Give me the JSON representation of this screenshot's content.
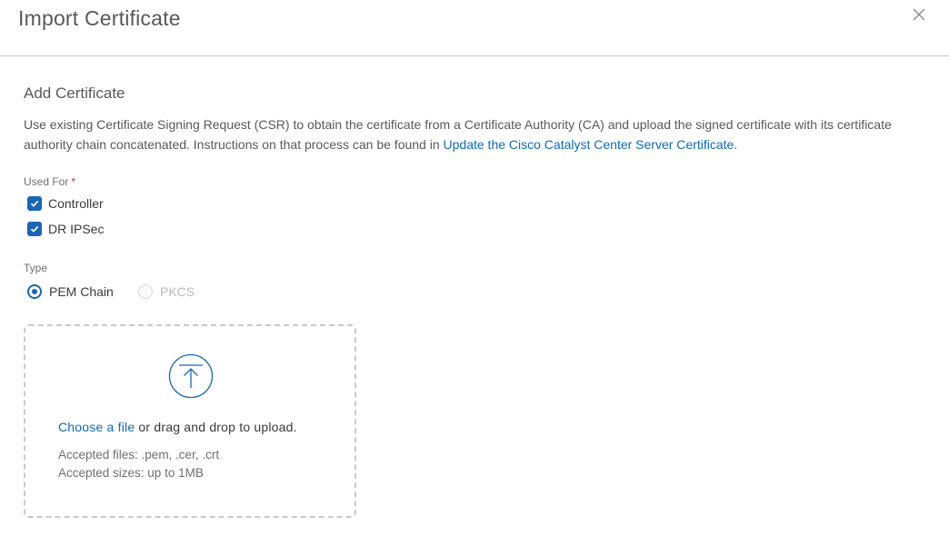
{
  "dialog": {
    "title": "Import Certificate",
    "close_icon": "close-icon"
  },
  "section": {
    "title": "Add Certificate",
    "description_text": "Use existing Certificate Signing Request (CSR) to obtain the certificate from a Certificate Authority (CA) and upload the signed certificate with its certificate authority chain concatenated. Instructions on that process can be found in",
    "description_link": "Update the Cisco Catalyst Center Server Certificate",
    "description_end": "."
  },
  "used_for": {
    "label": "Used For",
    "required_mark": "*",
    "options": [
      {
        "label": "Controller",
        "checked": true
      },
      {
        "label": "DR IPSec",
        "checked": true
      }
    ]
  },
  "type": {
    "label": "Type",
    "options": [
      {
        "label": "PEM Chain",
        "selected": true,
        "disabled": false
      },
      {
        "label": "PKCS",
        "selected": false,
        "disabled": true
      }
    ]
  },
  "upload": {
    "icon": "upload-arrow-icon",
    "choose_link": "Choose a file",
    "drag_text": "or drag and drop to upload.",
    "accepted_files": "Accepted files: .pem, .cer, .crt",
    "accepted_sizes": "Accepted sizes: up to 1MB"
  },
  "colors": {
    "accent": "#1b66b4",
    "link": "#0d6bb8",
    "required": "#e2231a"
  }
}
